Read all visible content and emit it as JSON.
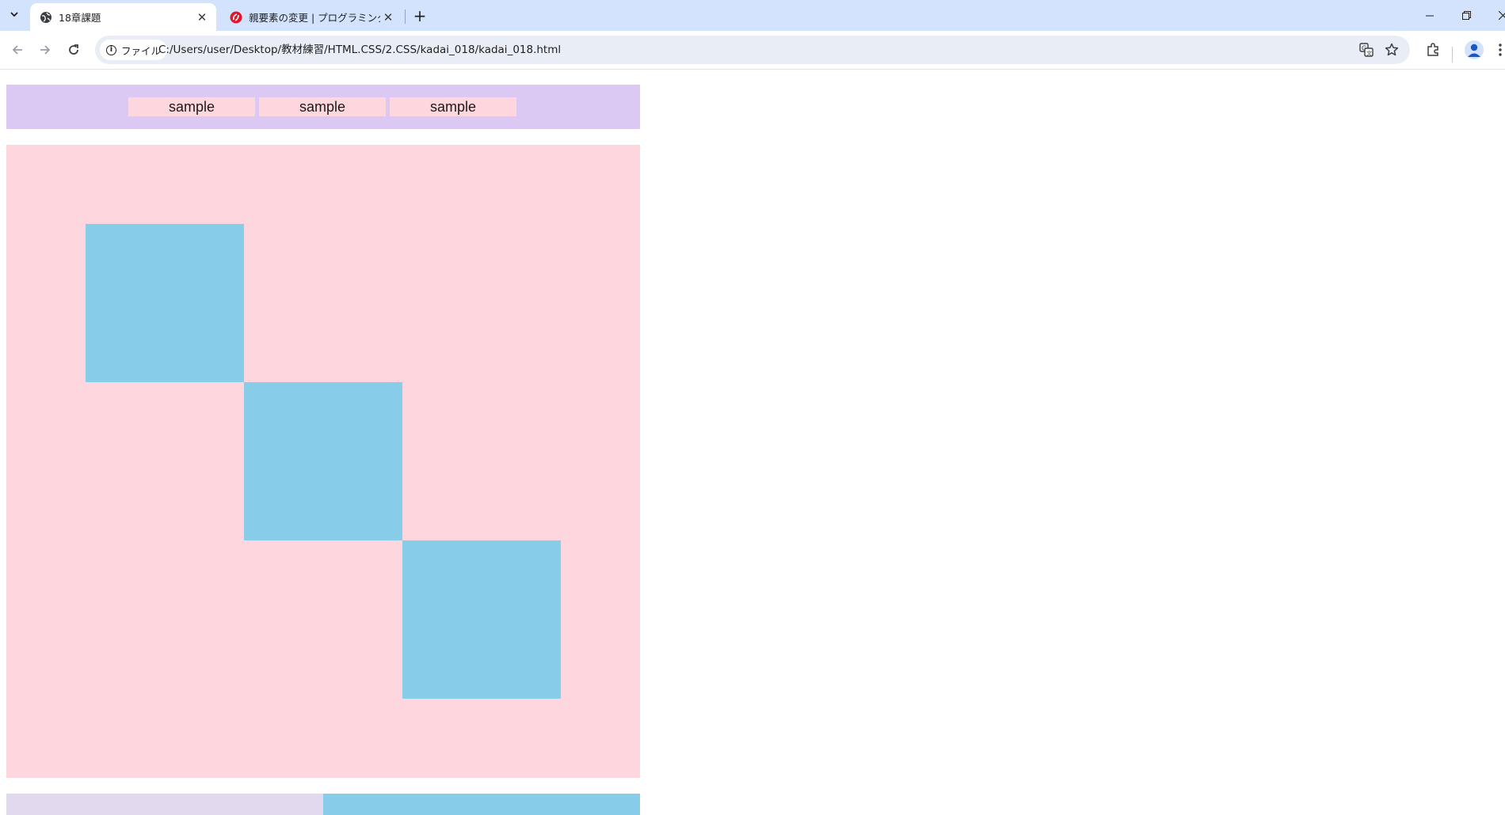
{
  "browser": {
    "tabs": [
      {
        "title": "18章課題",
        "active": true,
        "favicon": "globe-icon"
      },
      {
        "title": "親要素の変更 | プログラミング学習",
        "active": false,
        "favicon": "samurai-logo-icon"
      }
    ],
    "address": {
      "chip_label": "ファイル",
      "url": "C:/Users/user/Desktop/教材練習/HTML.CSS/2.CSS/kadai_018/kadai_018.html"
    }
  },
  "page": {
    "nav_items": [
      "sample",
      "sample",
      "sample"
    ],
    "colors": {
      "header_bg": "#dcc9f3",
      "nav_item_bg": "#fdd6de",
      "main_bg": "#fdd6de",
      "square": "#87cdea",
      "bottom_left": "#e3d9ef",
      "bottom_right": "#87cdea"
    }
  }
}
